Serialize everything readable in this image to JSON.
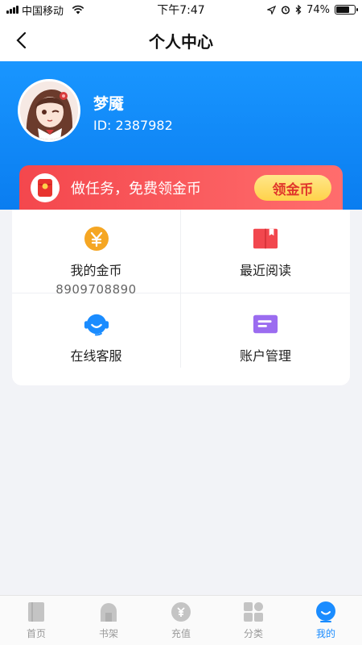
{
  "status_bar": {
    "carrier": "中国移动",
    "time": "下午7:47",
    "battery": "74%",
    "battery_level": 0.74
  },
  "nav": {
    "title": "个人中心",
    "back_icon": "chevron-left-icon"
  },
  "profile": {
    "name": "梦魇",
    "id_text": "ID: 2387982"
  },
  "banner": {
    "text": "做任务，免费领金币",
    "button_label": "领金币"
  },
  "grid": [
    {
      "label": "我的金币",
      "sub": "8909708890",
      "icon": "coin-icon",
      "color": "#f5a623"
    },
    {
      "label": "最近阅读",
      "sub": "",
      "icon": "book-icon",
      "color": "#f2474e"
    },
    {
      "label": "在线客服",
      "sub": "",
      "icon": "headset-icon",
      "color": "#1a8cff"
    },
    {
      "label": "账户管理",
      "sub": "",
      "icon": "card-icon",
      "color": "#9b6cf0"
    }
  ],
  "tabs": [
    {
      "label": "首页",
      "icon": "home-icon",
      "active": false
    },
    {
      "label": "书架",
      "icon": "bookshelf-icon",
      "active": false
    },
    {
      "label": "充值",
      "icon": "recharge-icon",
      "active": false
    },
    {
      "label": "分类",
      "icon": "category-icon",
      "active": false
    },
    {
      "label": "我的",
      "icon": "profile-icon",
      "active": true
    }
  ],
  "colors": {
    "brand": "#1a8cff",
    "banner_red": "#f4474d",
    "button_yellow": "#ffd24a",
    "inactive_tab": "#999999"
  }
}
